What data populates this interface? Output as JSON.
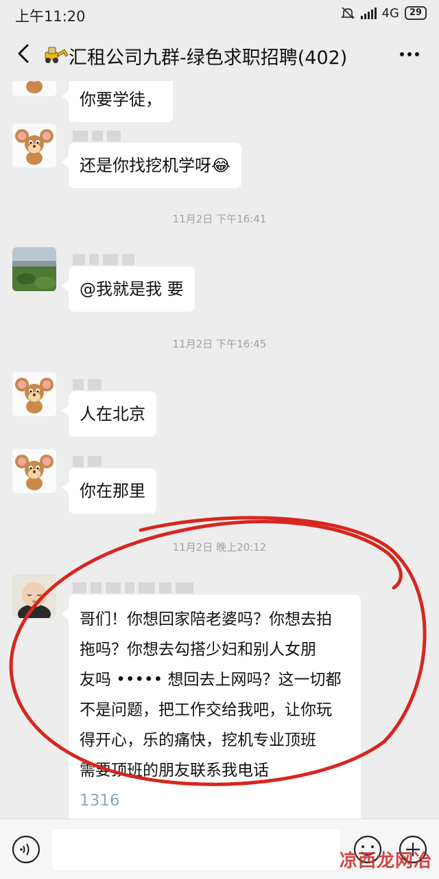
{
  "status_bar": {
    "time": "上午11:20",
    "network": "4G",
    "battery": "29"
  },
  "header": {
    "title": "汇租公司九群-绿色求职招聘(402)",
    "back_icon": "chevron-left-icon",
    "more_icon": "more-dots-icon",
    "group_icon": "excavator-icon"
  },
  "chat": {
    "messages": [
      {
        "avatar": "jerry-mouse-avatar",
        "text": "你要学徒，"
      },
      {
        "avatar": "jerry-mouse-avatar",
        "text": "还是你找挖机学呀😂"
      },
      {
        "type": "time",
        "text": "11月2日 下午16:41"
      },
      {
        "avatar": "landscape-avatar",
        "text": "@我就是我  要"
      },
      {
        "type": "time",
        "text": "11月2日 下午16:45"
      },
      {
        "avatar": "jerry-mouse-avatar",
        "text": "人在北京"
      },
      {
        "avatar": "jerry-mouse-avatar",
        "text": "你在那里"
      },
      {
        "type": "time",
        "text": "11月2日 晚上20:12"
      },
      {
        "avatar": "baby-avatar",
        "lines": [
          "哥们！你想回家陪老婆吗？你想去拍",
          "拖吗？你想去勾搭少妇和别人女朋",
          "友吗 •••••  想回去上网吗？这一切都",
          "不是问题，把工作交给我吧，让你玩",
          "得开心，乐的痛快，挖机专业顶班",
          "需要顶班的朋友联系我电话",
          "1316"
        ]
      }
    ]
  },
  "input_bar": {
    "voice_icon": "voice-icon",
    "emoji_icon": "emoji-icon",
    "plus_icon": "plus-icon"
  },
  "watermark": "凉西龙网冶",
  "colors": {
    "background": "#ededed",
    "bubble": "#ffffff",
    "annotation_red": "#d7261e"
  }
}
